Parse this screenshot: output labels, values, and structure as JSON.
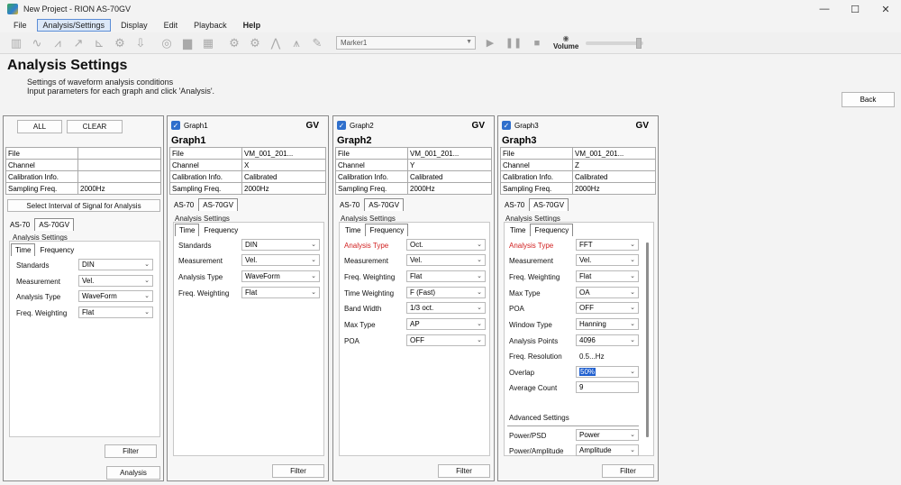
{
  "window": {
    "title": "New Project - RION AS-70GV",
    "minimize": "—",
    "maximize": "☐",
    "close": "✕"
  },
  "menu": [
    "File",
    "Analysis/Settings",
    "Display",
    "Edit",
    "Playback",
    "Help"
  ],
  "toolbar": {
    "marker": "Marker1",
    "volume_label": "Volume"
  },
  "header": {
    "title": "Analysis Settings",
    "desc1": "Settings of waveform analysis conditions",
    "desc2": "Input parameters for each graph and click 'Analysis'.",
    "back": "Back"
  },
  "left": {
    "all": "ALL",
    "clear": "CLEAR",
    "info": [
      {
        "label": "File",
        "value": ""
      },
      {
        "label": "Channel",
        "value": ""
      },
      {
        "label": "Calibration Info.",
        "value": ""
      },
      {
        "label": "Sampling Freq.",
        "value": "2000Hz"
      }
    ],
    "select_interval": "Select Interval of Signal for Analysis",
    "model_tabs": [
      "AS-70",
      "AS-70GV"
    ],
    "section": "Analysis Settings",
    "sub_tabs": [
      "Time",
      "Frequency"
    ],
    "rows": [
      {
        "label": "Standards",
        "value": "DIN"
      },
      {
        "label": "Measurement",
        "value": "Vel."
      },
      {
        "label": "Analysis Type",
        "value": "WaveForm"
      },
      {
        "label": "Freq. Weighting",
        "value": "Flat"
      }
    ],
    "filter": "Filter",
    "analysis": "Analysis"
  },
  "graph1": {
    "check_label": "Graph1",
    "gv": "GV",
    "title": "Graph1",
    "info": [
      {
        "label": "File",
        "value": "VM_001_201..."
      },
      {
        "label": "Channel",
        "value": "X"
      },
      {
        "label": "Calibration Info.",
        "value": "Calibrated"
      },
      {
        "label": "Sampling Freq.",
        "value": "2000Hz"
      }
    ],
    "model_tabs": [
      "AS-70",
      "AS-70GV"
    ],
    "section": "Analysis Settings",
    "sub_tabs": [
      "Time",
      "Frequency"
    ],
    "rows": [
      {
        "label": "Standards",
        "value": "DIN"
      },
      {
        "label": "Measurement",
        "value": "Vel."
      },
      {
        "label": "Analysis Type",
        "value": "WaveForm"
      },
      {
        "label": "Freq. Weighting",
        "value": "Flat"
      }
    ],
    "filter": "Filter"
  },
  "graph2": {
    "check_label": "Graph2",
    "gv": "GV",
    "title": "Graph2",
    "info": [
      {
        "label": "File",
        "value": "VM_001_201..."
      },
      {
        "label": "Channel",
        "value": "Y"
      },
      {
        "label": "Calibration Info.",
        "value": "Calibrated"
      },
      {
        "label": "Sampling Freq.",
        "value": "2000Hz"
      }
    ],
    "model_tabs": [
      "AS-70",
      "AS-70GV"
    ],
    "section": "Analysis Settings",
    "sub_tabs": [
      "Time",
      "Frequency"
    ],
    "rows": [
      {
        "label": "Analysis Type",
        "value": "Oct."
      },
      {
        "label": "Measurement",
        "value": "Vel."
      },
      {
        "label": "Freq. Weighting",
        "value": "Flat"
      },
      {
        "label": "Time Weighting",
        "value": "F (Fast)"
      },
      {
        "label": "Band Width",
        "value": "1/3 oct."
      },
      {
        "label": "Max Type",
        "value": "AP"
      },
      {
        "label": "POA",
        "value": "OFF"
      }
    ],
    "filter": "Filter"
  },
  "graph3": {
    "check_label": "Graph3",
    "gv": "GV",
    "title": "Graph3",
    "info": [
      {
        "label": "File",
        "value": "VM_001_201..."
      },
      {
        "label": "Channel",
        "value": "Z"
      },
      {
        "label": "Calibration Info.",
        "value": "Calibrated"
      },
      {
        "label": "Sampling Freq.",
        "value": "2000Hz"
      }
    ],
    "model_tabs": [
      "AS-70",
      "AS-70GV"
    ],
    "section": "Analysis Settings",
    "sub_tabs": [
      "Time",
      "Frequency"
    ],
    "rows": [
      {
        "label": "Analysis Type",
        "value": "FFT"
      },
      {
        "label": "Measurement",
        "value": "Vel."
      },
      {
        "label": "Freq. Weighting",
        "value": "Flat"
      },
      {
        "label": "Max Type",
        "value": "OA"
      },
      {
        "label": "POA",
        "value": "OFF"
      },
      {
        "label": "Window Type",
        "value": "Hanning"
      },
      {
        "label": "Analysis Points",
        "value": "4096"
      },
      {
        "label": "Freq. Resolution",
        "value": "0.5...Hz"
      },
      {
        "label": "Overlap",
        "value": "50%"
      },
      {
        "label": "Average Count",
        "value": "9"
      }
    ],
    "advanced": "Advanced Settings",
    "adv_rows": [
      {
        "label": "Power/PSD",
        "value": "Power"
      },
      {
        "label": "Power/Amplitude",
        "value": "Amplitude"
      }
    ],
    "filter": "Filter"
  }
}
